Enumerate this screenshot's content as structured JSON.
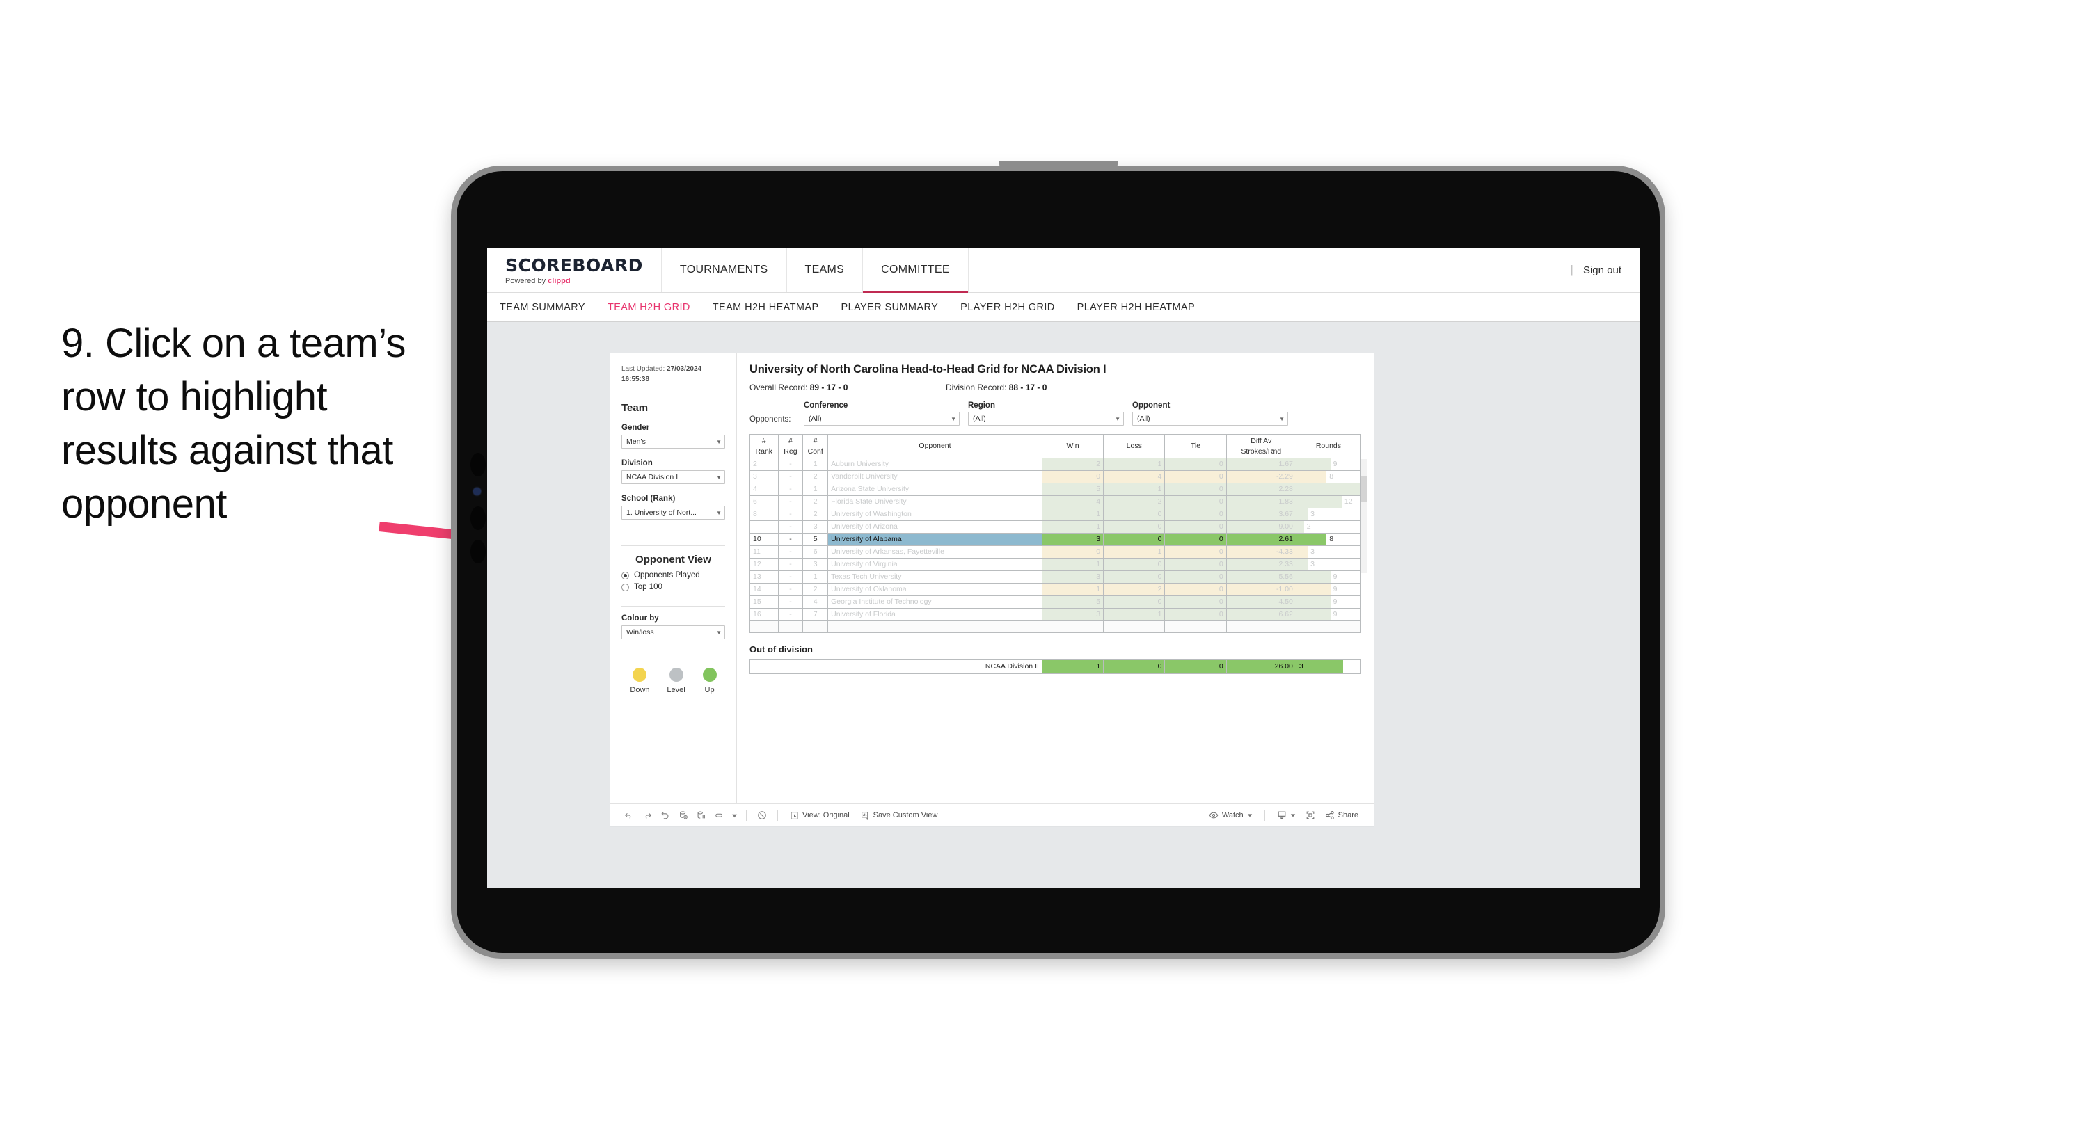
{
  "annotation": {
    "text": "9. Click on a team’s row to highlight results against that opponent",
    "arrow_color": "#ef3e6d"
  },
  "header": {
    "brand_title": "SCOREBOARD",
    "brand_sub_prefix": "Powered by ",
    "brand_sub_name": "clippd",
    "nav": [
      {
        "label": "TOURNAMENTS",
        "active": false
      },
      {
        "label": "TEAMS",
        "active": false
      },
      {
        "label": "COMMITTEE",
        "active": true
      }
    ],
    "divider": "|",
    "sign_out": "Sign out",
    "accent": "#e8336d"
  },
  "subnav": {
    "items": [
      {
        "label": "TEAM SUMMARY",
        "active": false
      },
      {
        "label": "TEAM H2H GRID",
        "active": true
      },
      {
        "label": "TEAM H2H HEATMAP",
        "active": false
      },
      {
        "label": "PLAYER SUMMARY",
        "active": false
      },
      {
        "label": "PLAYER H2H GRID",
        "active": false
      },
      {
        "label": "PLAYER H2H HEATMAP",
        "active": false
      }
    ]
  },
  "sidebar": {
    "last_updated_label": "Last Updated:",
    "last_updated_value": "27/03/2024",
    "last_updated_time": "16:55:38",
    "team_heading": "Team",
    "gender_label": "Gender",
    "gender_value": "Men’s",
    "division_label": "Division",
    "division_value": "NCAA Division I",
    "school_label": "School (Rank)",
    "school_value": "1. University of Nort...",
    "opponent_view_heading": "Opponent View",
    "opponent_view_options": [
      {
        "label": "Opponents Played",
        "selected": true
      },
      {
        "label": "Top 100",
        "selected": false
      }
    ],
    "colour_by_label": "Colour by",
    "colour_by_value": "Win/loss",
    "legend": [
      {
        "label": "Down",
        "color": "#f3d44f"
      },
      {
        "label": "Level",
        "color": "#bdc1c4"
      },
      {
        "label": "Up",
        "color": "#82c45d"
      }
    ]
  },
  "main": {
    "title": "University of North Carolina Head-to-Head Grid for NCAA Division I",
    "overall_record_label": "Overall Record:",
    "overall_record_value": "89 - 17 - 0",
    "division_record_label": "Division Record:",
    "division_record_value": "88 - 17 - 0",
    "opponents_label": "Opponents:",
    "filters": [
      {
        "label": "Conference",
        "value": "(All)"
      },
      {
        "label": "Region",
        "value": "(All)"
      },
      {
        "label": "Opponent",
        "value": "(All)"
      }
    ]
  },
  "chart_data": {
    "type": "table",
    "title": "University of North Carolina Head-to-Head Grid for NCAA Division I",
    "columns": [
      "# Rank",
      "# Reg",
      "# Conf",
      "Opponent",
      "Win",
      "Loss",
      "Tie",
      "Diff Av Strokes/Rnd",
      "Rounds"
    ],
    "column_header_lines": [
      [
        "#",
        "Rank"
      ],
      [
        "#",
        "Reg"
      ],
      [
        "#",
        "Conf"
      ],
      [
        "Opponent"
      ],
      [
        "Win"
      ],
      [
        "Loss"
      ],
      [
        "Tie"
      ],
      [
        "Diff Av",
        "Strokes/Rnd"
      ],
      [
        "Rounds"
      ]
    ],
    "rounds_max": 17,
    "rows": [
      {
        "rank": "2",
        "reg": "-",
        "conf": "1",
        "opponent": "Auburn University",
        "win": "2",
        "loss": "1",
        "tie": "0",
        "diff": "1.67",
        "rounds": "9",
        "tone": "green",
        "selected": false
      },
      {
        "rank": "3",
        "reg": "-",
        "conf": "2",
        "opponent": "Vanderbilt University",
        "win": "0",
        "loss": "4",
        "tie": "0",
        "diff": "-2.29",
        "rounds": "8",
        "tone": "amber",
        "selected": false
      },
      {
        "rank": "4",
        "reg": "-",
        "conf": "1",
        "opponent": "Arizona State University",
        "win": "5",
        "loss": "1",
        "tie": "0",
        "diff": "2.28",
        "rounds": "17",
        "tone": "green",
        "selected": false
      },
      {
        "rank": "6",
        "reg": "-",
        "conf": "2",
        "opponent": "Florida State University",
        "win": "4",
        "loss": "2",
        "tie": "0",
        "diff": "1.83",
        "rounds": "12",
        "tone": "green",
        "selected": false
      },
      {
        "rank": "8",
        "reg": "-",
        "conf": "2",
        "opponent": "University of Washington",
        "win": "1",
        "loss": "0",
        "tie": "0",
        "diff": "3.67",
        "rounds": "3",
        "tone": "green",
        "selected": false
      },
      {
        "rank": "",
        "reg": "-",
        "conf": "3",
        "opponent": "University of Arizona",
        "win": "1",
        "loss": "0",
        "tie": "0",
        "diff": "9.00",
        "rounds": "2",
        "tone": "green",
        "selected": false
      },
      {
        "rank": "10",
        "reg": "-",
        "conf": "5",
        "opponent": "University of Alabama",
        "win": "3",
        "loss": "0",
        "tie": "0",
        "diff": "2.61",
        "rounds": "8",
        "tone": "green",
        "selected": true
      },
      {
        "rank": "11",
        "reg": "-",
        "conf": "6",
        "opponent": "University of Arkansas, Fayetteville",
        "win": "0",
        "loss": "1",
        "tie": "0",
        "diff": "-4.33",
        "rounds": "3",
        "tone": "amber",
        "selected": false
      },
      {
        "rank": "12",
        "reg": "-",
        "conf": "3",
        "opponent": "University of Virginia",
        "win": "1",
        "loss": "0",
        "tie": "0",
        "diff": "2.33",
        "rounds": "3",
        "tone": "green",
        "selected": false
      },
      {
        "rank": "13",
        "reg": "-",
        "conf": "1",
        "opponent": "Texas Tech University",
        "win": "3",
        "loss": "0",
        "tie": "0",
        "diff": "5.56",
        "rounds": "9",
        "tone": "green",
        "selected": false
      },
      {
        "rank": "14",
        "reg": "-",
        "conf": "2",
        "opponent": "University of Oklahoma",
        "win": "1",
        "loss": "2",
        "tie": "0",
        "diff": "-1.00",
        "rounds": "9",
        "tone": "amber",
        "selected": false
      },
      {
        "rank": "15",
        "reg": "-",
        "conf": "4",
        "opponent": "Georgia Institute of Technology",
        "win": "5",
        "loss": "0",
        "tie": "0",
        "diff": "4.50",
        "rounds": "9",
        "tone": "green",
        "selected": false
      },
      {
        "rank": "16",
        "reg": "-",
        "conf": "7",
        "opponent": "University of Florida",
        "win": "3",
        "loss": "1",
        "tie": "0",
        "diff": "6.62",
        "rounds": "9",
        "tone": "green",
        "selected": false
      }
    ]
  },
  "out_of_division": {
    "heading": "Out of division",
    "row": {
      "name": "NCAA Division II",
      "win": "1",
      "loss": "0",
      "tie": "0",
      "diff": "26.00",
      "rounds": "3"
    }
  },
  "toolbar": {
    "icons": [
      "undo-icon",
      "redo-icon",
      "revert-icon",
      "refresh-icon",
      "pause-icon",
      "alerts-icon",
      "alerts-caret-icon",
      "data-details-icon"
    ],
    "view_label": "View: Original",
    "save_custom_view_label": "Save Custom View",
    "watch_label": "Watch",
    "share_label": "Share"
  }
}
